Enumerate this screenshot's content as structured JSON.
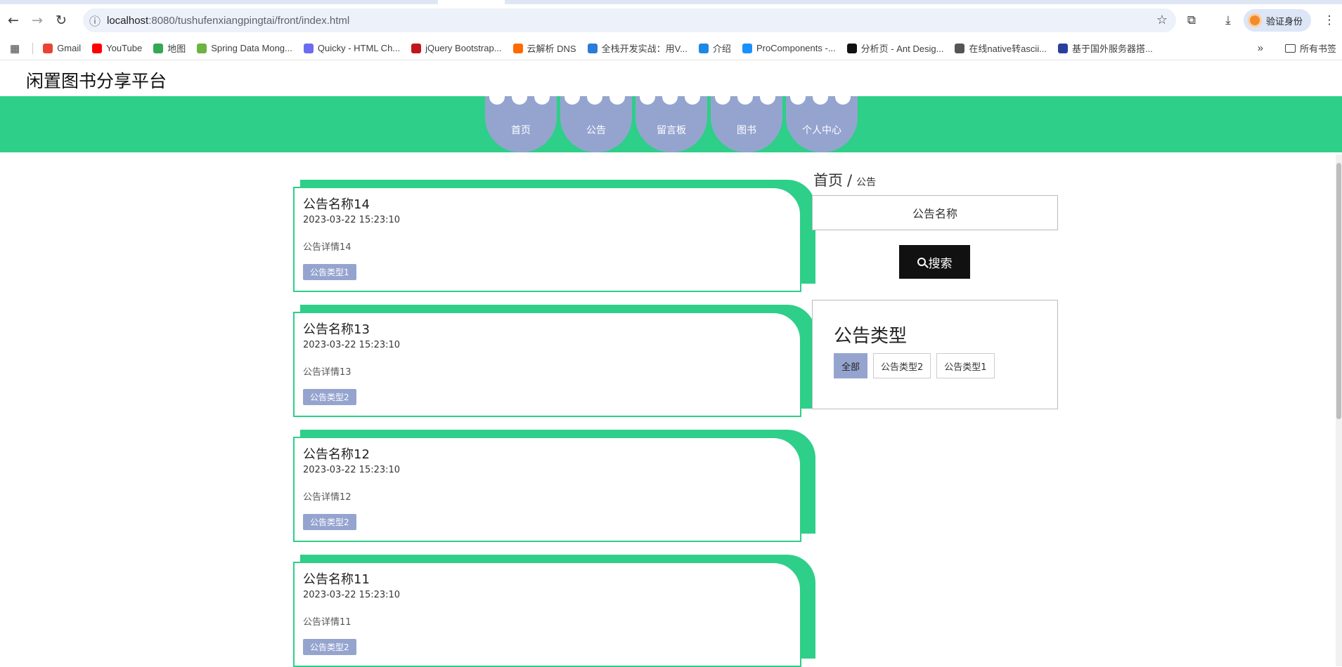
{
  "browser": {
    "url_host": "localhost",
    "url_path": ":8080/tushufenxiangpingtai/front/index.html",
    "profile_label": "验证身份",
    "bookmarks": [
      {
        "label": "Gmail",
        "color": "#ea4335"
      },
      {
        "label": "YouTube",
        "color": "#ff0000"
      },
      {
        "label": "地图",
        "color": "#34a853"
      },
      {
        "label": "Spring Data Mong...",
        "color": "#6db33f"
      },
      {
        "label": "Quicky - HTML Ch...",
        "color": "#6c6cf0"
      },
      {
        "label": "jQuery Bootstrap...",
        "color": "#c0161c"
      },
      {
        "label": "云解析 DNS",
        "color": "#ff6a00"
      },
      {
        "label": "全栈开发实战：用V...",
        "color": "#2b7bd9"
      },
      {
        "label": "介绍",
        "color": "#1e88e5"
      },
      {
        "label": "ProComponents -...",
        "color": "#1890ff"
      },
      {
        "label": "分析页 - Ant Desig...",
        "color": "#111111"
      },
      {
        "label": "在线native转ascii...",
        "color": "#555555"
      },
      {
        "label": "基于国外服务器搭...",
        "color": "#2a3f9d"
      }
    ],
    "bookmarks_folder": "所有书签"
  },
  "site": {
    "title": "闲置图书分享平台",
    "nav": [
      "首页",
      "公告",
      "留言板",
      "图书",
      "个人中心"
    ],
    "colors": {
      "band": "#2ecf88",
      "nav_item": "#95a4cf"
    }
  },
  "notices": [
    {
      "title": "公告名称14",
      "time": "2023-03-22 15:23:10",
      "detail": "公告详情14",
      "type": "公告类型1"
    },
    {
      "title": "公告名称13",
      "time": "2023-03-22 15:23:10",
      "detail": "公告详情13",
      "type": "公告类型2"
    },
    {
      "title": "公告名称12",
      "time": "2023-03-22 15:23:10",
      "detail": "公告详情12",
      "type": "公告类型2"
    },
    {
      "title": "公告名称11",
      "time": "2023-03-22 15:23:10",
      "detail": "公告详情11",
      "type": "公告类型2"
    }
  ],
  "sidebar": {
    "breadcrumb": {
      "home": "首页",
      "separator": "/",
      "current": "公告"
    },
    "search_placeholder": "公告名称",
    "search_button": "搜索",
    "types_heading": "公告类型",
    "types": [
      "全部",
      "公告类型2",
      "公告类型1"
    ],
    "active_type": "全部"
  }
}
